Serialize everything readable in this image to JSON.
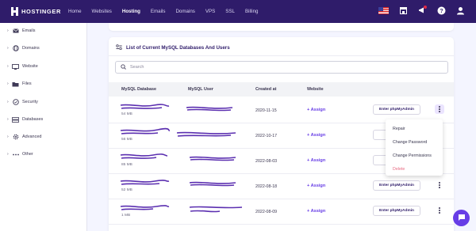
{
  "brand": {
    "name": "HOSTINGER"
  },
  "nav": [
    {
      "label": "Home",
      "active": false
    },
    {
      "label": "Websites",
      "active": false
    },
    {
      "label": "Hosting",
      "active": true
    },
    {
      "label": "Emails",
      "active": false
    },
    {
      "label": "Domains",
      "active": false
    },
    {
      "label": "VPS",
      "active": false
    },
    {
      "label": "SSL",
      "active": false
    },
    {
      "label": "Billing",
      "active": false
    }
  ],
  "topbar_icons": [
    "us-flag-icon",
    "store-icon",
    "notification-icon",
    "help-icon",
    "account-icon"
  ],
  "sidebar": {
    "items": [
      {
        "label": "Emails",
        "icon": "mail-icon"
      },
      {
        "label": "Domains",
        "icon": "globe-icon"
      },
      {
        "label": "Website",
        "icon": "monitor-icon"
      },
      {
        "label": "Files",
        "icon": "folder-icon"
      },
      {
        "label": "Security",
        "icon": "shield-icon"
      },
      {
        "label": "Databases",
        "icon": "database-icon"
      },
      {
        "label": "Advanced",
        "icon": "gear-icon"
      },
      {
        "label": "Other",
        "icon": "more-icon"
      }
    ]
  },
  "panel": {
    "title": "List of Current MySQL Databases And Users",
    "search_placeholder": "Search",
    "columns": {
      "database": "MySQL Database",
      "user": "MySQL User",
      "created": "Created at",
      "website": "Website"
    },
    "assign_label": "+ Assign",
    "pma_label": "Enter phpMyAdmin",
    "pma_label_short": "Ente",
    "rows": [
      {
        "size": "54 MB",
        "created": "2020-11-15"
      },
      {
        "size": "56 MB",
        "created": "2022-10-17"
      },
      {
        "size": "85 MB",
        "created": "2022-08-03"
      },
      {
        "size": "52 MB",
        "created": "2022-08-18"
      },
      {
        "size": "1 MB",
        "created": "2022-08-09"
      }
    ]
  },
  "dropdown": {
    "items": [
      {
        "label": "Repair",
        "danger": false
      },
      {
        "label": "Change Password",
        "danger": false
      },
      {
        "label": "Change Permissions",
        "danger": false
      },
      {
        "label": "Delete",
        "danger": true
      }
    ]
  },
  "colors": {
    "topbar": "#2f1c6a",
    "accent": "#673de6",
    "danger": "#e86a82",
    "redaction": "#5b2fb0"
  }
}
